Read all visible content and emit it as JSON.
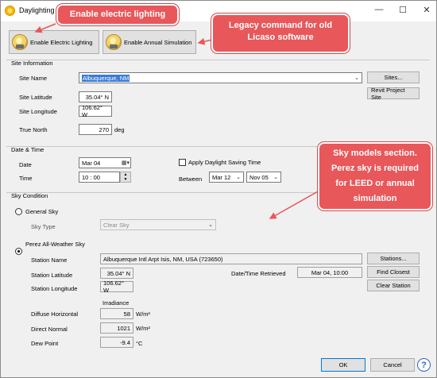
{
  "window": {
    "title": "Daylighting",
    "help_label": "?"
  },
  "toolbar": {
    "enable_electric_lighting": "Enable Electric Lighting",
    "enable_annual_simulation": "Enable Annual Simulation"
  },
  "site_information": {
    "section_title": "Site Information",
    "site_name_label": "Site Name",
    "site_name_value": "Albuquerque, NM",
    "sites_button": "Sites...",
    "revit_project_site_button": "Revit Project Site",
    "latitude_label": "Site Latitude",
    "latitude_value": "35.04° N",
    "longitude_label": "Site Longitude",
    "longitude_value": "106.62° W",
    "true_north_label": "True North",
    "true_north_value": "270",
    "true_north_unit": "deg"
  },
  "date_time": {
    "section_title": "Date & Time",
    "date_label": "Date",
    "date_value": "Mar 04",
    "time_label": "Time",
    "time_value": "10 : 00",
    "dst_label": "Apply Daylight Saving Time",
    "between_label": "Between",
    "between_start": "Mar 12",
    "between_end": "Nov 05"
  },
  "sky_condition": {
    "section_title": "Sky Condition",
    "general_sky_label": "General Sky",
    "sky_type_label": "Sky Type",
    "sky_type_value": "Clear Sky",
    "perez_label": "Perez All-Weather Sky",
    "station_name_label": "Station Name",
    "station_name_value": "Albuquerque Intl Arpt  Isis, NM, USA (723650)",
    "stations_button": "Stations...",
    "station_latitude_label": "Station Latitude",
    "station_latitude_value": "35.04° N",
    "datetime_retrieved_label": "Date/Time Retrieved",
    "datetime_retrieved_value": "Mar 04, 10:00",
    "find_closest_button": "Find Closest",
    "station_longitude_label": "Station Longitude",
    "station_longitude_value": "106.62° W",
    "clear_station_button": "Clear Station",
    "irradiance_label": "Irradiance",
    "diffuse_label": "Diffuse Horizontal",
    "diffuse_value": "58",
    "diffuse_unit": "W/m²",
    "direct_label": "Direct Normal",
    "direct_value": "1021",
    "direct_unit": "W/m²",
    "dew_label": "Dew Point",
    "dew_value": "-9.4",
    "dew_unit": "°C"
  },
  "footer": {
    "ok_button": "OK",
    "cancel_button": "Cancel"
  },
  "callouts": {
    "electric": "Enable electric lighting",
    "legacy_line1": "Legacy command for old",
    "legacy_line2": "Licaso software",
    "sky_line1": "Sky models section.",
    "sky_line2": "Perez sky is required",
    "sky_line3": "for LEED or annual",
    "sky_line4": "simulation"
  },
  "colors": {
    "callout": "#e8575a",
    "selection": "#3a7bd5"
  }
}
